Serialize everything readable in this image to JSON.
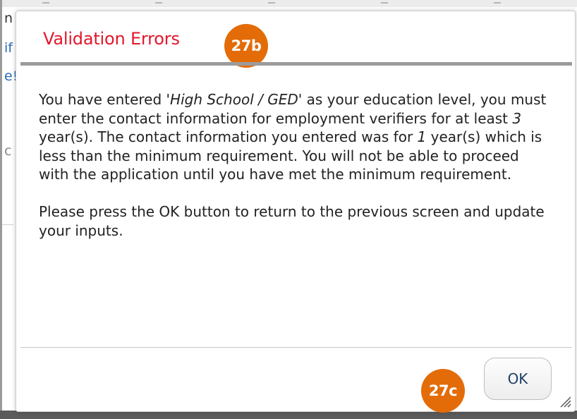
{
  "background": {
    "fragments": [
      "n",
      "if",
      "e!",
      "c"
    ]
  },
  "dialog": {
    "title": "Validation Errors",
    "title_color": "#e0182d",
    "callout_title": "27b",
    "callout_ok": "27c",
    "callout_color": "#e36c09",
    "body": {
      "p1_part1": "You have entered '",
      "p1_education": "High School / GED",
      "p1_part2": "' as your education level, you must enter the contact information for employment verifiers for at least ",
      "p1_years_required": "3",
      "p1_part3": " year(s). The contact information you entered was for ",
      "p1_years_entered": "1",
      "p1_part4": " year(s) which is less than the minimum requirement. You will not be able to proceed with the application until you have met the minimum requirement.",
      "p2": "Please press the OK button to return to the previous screen and update your inputs."
    },
    "ok_label": "OK"
  }
}
